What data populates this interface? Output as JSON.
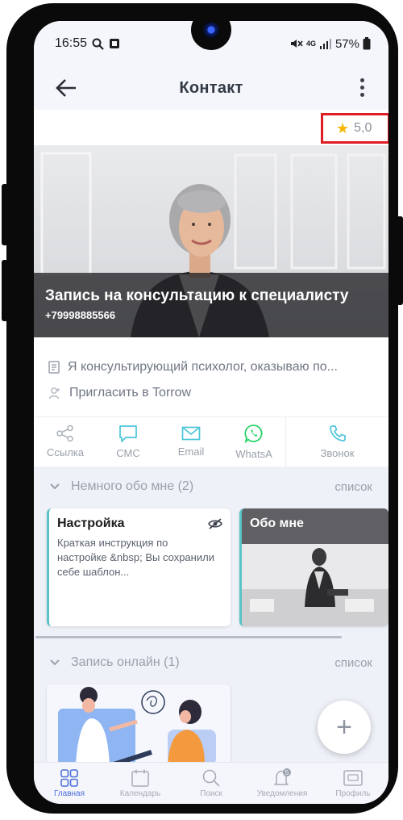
{
  "status_bar": {
    "time": "16:55",
    "network": "4G",
    "battery": "57%",
    "icons": [
      "search-icon",
      "notification-box-icon",
      "mute-icon",
      "signal-icon",
      "battery-icon"
    ]
  },
  "header": {
    "title": "Контакт",
    "back_icon": "arrow-left-icon",
    "more_icon": "more-vertical-icon"
  },
  "rating": {
    "value": "5,0",
    "icon": "star-icon"
  },
  "hero": {
    "title": "Запись на консультацию к специалисту",
    "phone": "+79998885566"
  },
  "info": {
    "description": "Я консультирующий психолог, оказываю по...",
    "invite": "Пригласить в Torrow"
  },
  "actions": [
    {
      "label": "Ссылка",
      "icon": "share-link-icon"
    },
    {
      "label": "СМС",
      "icon": "sms-bubble-icon"
    },
    {
      "label": "Email",
      "icon": "envelope-icon"
    },
    {
      "label": "WhatsA",
      "icon": "whatsapp-icon"
    },
    {
      "label": "Звонок",
      "icon": "phone-icon"
    }
  ],
  "sections": {
    "about": {
      "title": "Немного обо мне (2)",
      "list_link": "список",
      "cards": [
        {
          "title": "Настройка",
          "text": "Краткая инструкция по настройке &nbsp; Вы сохранили себе шаблон..."
        },
        {
          "title": "Обо мне"
        }
      ]
    },
    "online": {
      "title": "Запись онлайн (1)",
      "list_link": "список"
    }
  },
  "fab": {
    "label": "+"
  },
  "bottom_nav": [
    {
      "label": "Главная",
      "icon": "home-grid-icon",
      "active": true
    },
    {
      "label": "Календарь",
      "icon": "calendar-icon",
      "active": false
    },
    {
      "label": "Поиск",
      "icon": "search-icon",
      "active": false
    },
    {
      "label": "Уведомления",
      "icon": "bell-icon",
      "badge": "5",
      "active": false
    },
    {
      "label": "Профиль",
      "icon": "profile-card-icon",
      "active": false
    }
  ],
  "colors": {
    "accent": "#4d6fd9",
    "rating_highlight": "#e01c24",
    "star": "#f6b600",
    "card_border": "#58c4c8",
    "whatsapp": "#25d366"
  }
}
